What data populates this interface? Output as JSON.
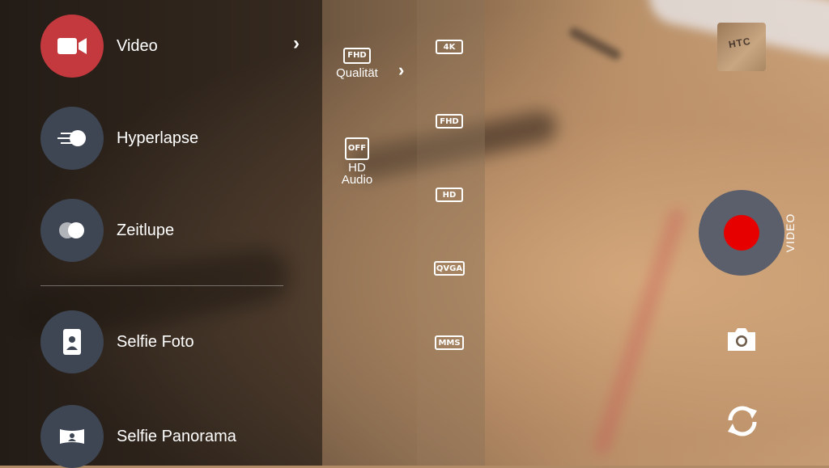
{
  "modes": [
    {
      "label": "Video",
      "icon": "video-camera-icon",
      "active": true
    },
    {
      "label": "Hyperlapse",
      "icon": "hyperlapse-icon",
      "active": false
    },
    {
      "label": "Zeitlupe",
      "icon": "slow-motion-icon",
      "active": false
    },
    {
      "label": "Selfie Foto",
      "icon": "selfie-photo-icon",
      "active": false
    },
    {
      "label": "Selfie Panorama",
      "icon": "selfie-panorama-icon",
      "active": false
    }
  ],
  "settings": {
    "quality": {
      "badge": "FHD",
      "label": "Qualität"
    },
    "hd_audio": {
      "badge": "OFF",
      "label_line1": "HD",
      "label_line2": "Audio"
    }
  },
  "resolutions": [
    "4K",
    "FHD",
    "HD",
    "QVGA",
    "MMS"
  ],
  "thumbnail_text": "HTC",
  "mode_indicator": "VIDEO",
  "colors": {
    "active_mode": "#c3393d",
    "mode_circle": "#3e4654",
    "record_dot": "#e60000",
    "shutter_ring": "#5b5f6b"
  }
}
